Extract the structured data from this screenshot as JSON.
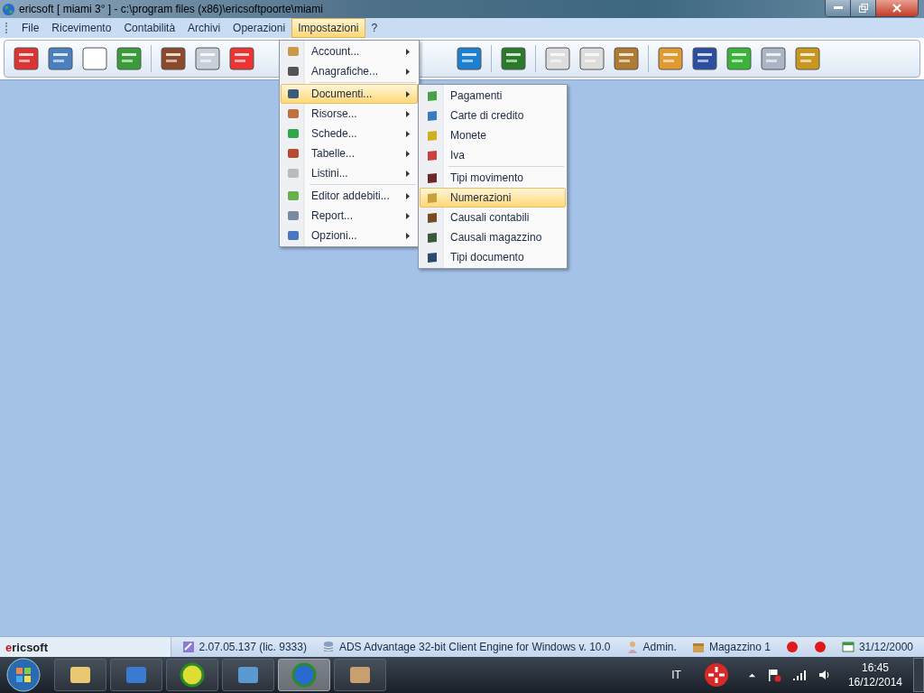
{
  "window": {
    "title": "ericsoft [ miami 3° ] - c:\\program files (x86)\\ericsoftpoorte\\miami"
  },
  "menu_bar": [
    {
      "label": "File",
      "selected": false
    },
    {
      "label": "Ricevimento",
      "selected": false
    },
    {
      "label": "Contabilità",
      "selected": false
    },
    {
      "label": "Archivi",
      "selected": false
    },
    {
      "label": "Operazioni",
      "selected": false
    },
    {
      "label": "Impostazioni",
      "selected": true
    },
    {
      "label": "?",
      "selected": false
    }
  ],
  "dropdown_menu": {
    "groups": [
      [
        {
          "label": "Account...",
          "selected": false
        },
        {
          "label": "Anagrafiche...",
          "selected": false
        }
      ],
      [
        {
          "label": "Documenti...",
          "selected": true
        },
        {
          "label": "Risorse...",
          "selected": false
        },
        {
          "label": "Schede...",
          "selected": false
        },
        {
          "label": "Tabelle...",
          "selected": false
        },
        {
          "label": "Listini...",
          "selected": false
        }
      ],
      [
        {
          "label": "Editor addebiti...",
          "selected": false
        },
        {
          "label": "Report...",
          "selected": false
        },
        {
          "label": "Opzioni...",
          "selected": false
        }
      ]
    ]
  },
  "submenu": {
    "groups": [
      [
        {
          "label": "Pagamenti",
          "selected": false
        },
        {
          "label": "Carte di credito",
          "selected": false
        },
        {
          "label": "Monete",
          "selected": false
        },
        {
          "label": "Iva",
          "selected": false
        }
      ],
      [
        {
          "label": "Tipi movimento",
          "selected": false
        },
        {
          "label": "Numerazioni",
          "selected": true
        },
        {
          "label": "Causali contabili",
          "selected": false
        },
        {
          "label": "Causali magazzino",
          "selected": false
        },
        {
          "label": "Tipi documento",
          "selected": false
        }
      ]
    ]
  },
  "status_bar": {
    "app_name": "ericsoft",
    "version": "2.07.05.137 (lic. 9333)",
    "engine": "ADS Advantage 32-bit Client Engine for Windows v. 10.0",
    "user": "Admin.",
    "warehouse": "Magazzino 1",
    "indicators": [
      {
        "color": "#e01818"
      },
      {
        "color": "#e01818"
      }
    ],
    "date": "31/12/2000"
  },
  "taskbar": {
    "buttons": [
      {
        "selected": false
      },
      {
        "selected": false
      },
      {
        "selected": false
      },
      {
        "selected": false
      },
      {
        "selected": true
      },
      {
        "selected": false
      }
    ],
    "language": "IT",
    "time": "16:45",
    "date": "16/12/2014"
  }
}
